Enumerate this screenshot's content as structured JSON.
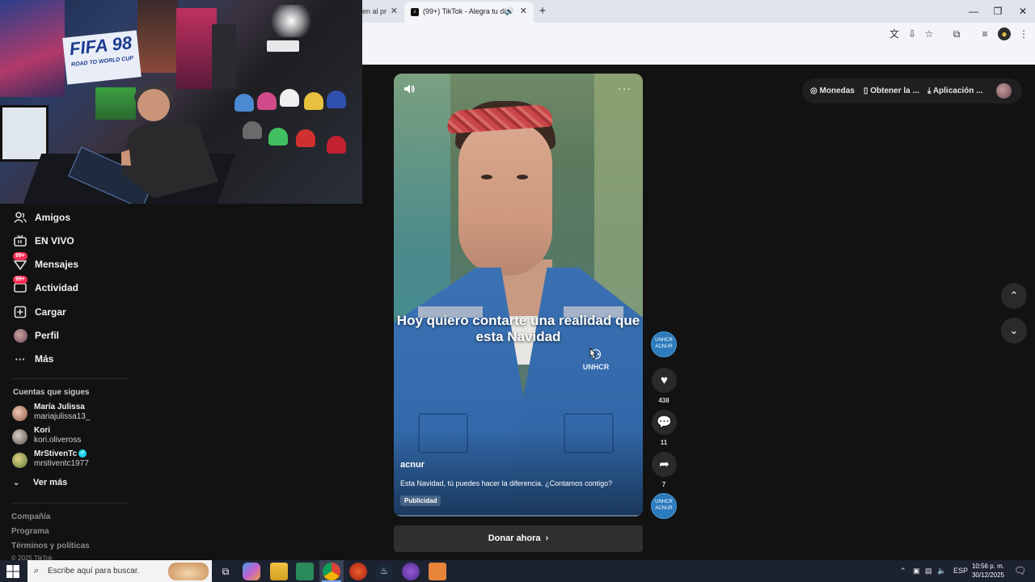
{
  "browser": {
    "tabs": [
      {
        "label": "en al pr",
        "active": false
      },
      {
        "label": "(99+) TikTok - Alegra tu día",
        "active": true
      }
    ],
    "new_tab": "+",
    "window_controls": {
      "minimize": "—",
      "restore": "❐",
      "close": "✕"
    }
  },
  "sidebar": {
    "items": [
      {
        "label": "Amigos",
        "icon": "friends-icon"
      },
      {
        "label": "EN VIVO",
        "icon": "live-icon"
      },
      {
        "label": "Mensajes",
        "icon": "messages-icon",
        "badge": "99+"
      },
      {
        "label": "Actividad",
        "icon": "activity-icon",
        "badge": "99+"
      },
      {
        "label": "Cargar",
        "icon": "upload-icon"
      },
      {
        "label": "Perfil",
        "icon": "profile-avatar"
      },
      {
        "label": "Más",
        "icon": "more-icon"
      }
    ],
    "following_title": "Cuentas que sigues",
    "following": [
      {
        "name": "María Julissa",
        "handle": "mariajulissa13_"
      },
      {
        "name": "Kori",
        "handle": "kori.oliveross"
      },
      {
        "name": "MrStivenTc",
        "handle": "mrstiventc1977",
        "verified": true
      }
    ],
    "see_more": "Ver más",
    "footer": [
      "Compañía",
      "Programa",
      "Términos y políticas",
      "© 2025 TikTok"
    ]
  },
  "header": {
    "coins": "Monedas",
    "get_app": "Obtener la ...",
    "app": "Aplicación ..."
  },
  "video": {
    "caption": "Hoy quiero contarte una realidad que esta Navidad",
    "author": "acnur",
    "description": "Esta Navidad, tú puedes hacer la diferencia. ¿Contamos contigo?",
    "ad_label": "Publicidad",
    "logo_text": "UNHCR",
    "more": "···",
    "cta": "Donar ahora"
  },
  "actions": {
    "likes": "438",
    "comments": "11",
    "shares": "7",
    "sponsor_avatar_text": "UNHCR ACNUR"
  },
  "taskbar": {
    "search_placeholder": "Escribe aquí para buscar.",
    "language": "ESP",
    "time": "10:56 p. m.",
    "date": "30/12/2025"
  },
  "colors": {
    "accent": "#fe2c55",
    "background": "#121212",
    "verified": "#20d5ec"
  }
}
